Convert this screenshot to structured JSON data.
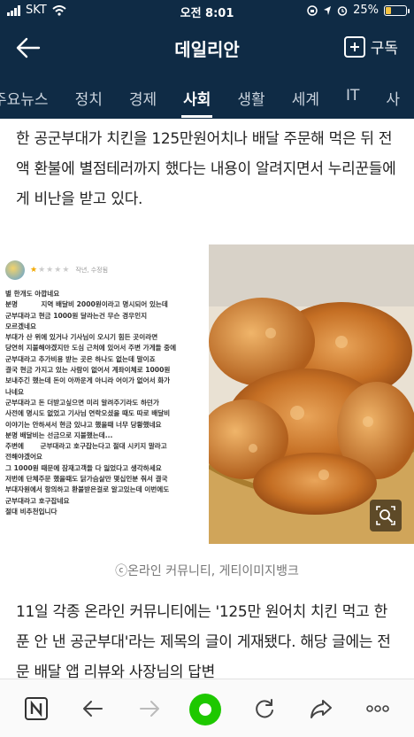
{
  "status_bar": {
    "carrier": "SKT",
    "time": "오전 8:01",
    "battery_percent": "25%",
    "battery_level": 0.25
  },
  "header": {
    "title": "데일리안",
    "subscribe_label": "구독",
    "back_icon": "back-arrow-icon"
  },
  "tabs": [
    {
      "label": "주요뉴스"
    },
    {
      "label": "정치"
    },
    {
      "label": "경제"
    },
    {
      "label": "사회"
    },
    {
      "label": "생활"
    },
    {
      "label": "세계"
    },
    {
      "label": "IT"
    },
    {
      "label": "사"
    }
  ],
  "article": {
    "intro": "한 공군부대가 치킨을 125만원어치나 배달 주문해 먹은 뒤 전액 환불에 별점테러까지 했다는 내용이 알려지면서 누리꾼들에게 비난을 받고 있다.",
    "review_meta": "작년, 수정됨",
    "review_text": "별 한개도 아깝네요\n분명          지역 배달비 2000원이라고 명시되어 있는데\n군부대라고 현금 1000원 달라는건 무슨 경우인지\n모르겠네요\n부대가 산 위에 있거나 기사님이 오시기 힘든 곳이라면\n당연히 지불해야겠지만 도심 근처에 있어서 주변 가게들 중에\n군부대라고 추가비용 받는 곳은 하나도 없는데 말이죠\n결국 현금 가지고 있는 사람이 없어서 계좌이체로 1000원\n보내주긴 했는데 돈이 아까운게 아니라 어이가 없어서 화가\n나네요\n군부대라고 돈 더받고싶으면 미리 알려주기라도 하던가\n사전에 명시도 없었고 기사님 연락오셨을 때도 따로 배달비\n이야기는 안하셔서 현금 있냐고 했을때 너무 당황했네요\n분명 배달비는 선금으로 지불했는데...\n주변에       군부대라고 호구잡는다고 절대 시키지 말라고\n전해야겠어요\n그 1000원 때문에 잠재고객들 다 잃었다고 생각하세요\n저번에 단체주문 했을때도 닭가슴살만 몇십인분 줘서 결국\n부대자원에서 항의하고 환불받은걸로 알고있는데 이번에도\n군부대라고 호구잡네요\n절대 비추천입니다",
    "rating": 1,
    "rating_max": 5,
    "caption": "ⓒ온라인 커뮤니티, 게티이미지뱅크",
    "body": "11일 각종 온라인 커뮤니티에는 '125만 원어치 치킨 먹고 한 푼 안 낸 공군부대'라는 제목의 글이 게재됐다. 해당 글에는 전문 배달 앱 리뷰와 사장님의 답변"
  },
  "bottom_bar": {
    "items": [
      "naver-n-icon",
      "back-arrow-icon",
      "forward-arrow-icon",
      "green-dot-icon",
      "refresh-icon",
      "share-icon",
      "more-icon"
    ]
  },
  "colors": {
    "header_bg": "#0f2b45",
    "accent_green": "#1ec800",
    "star": "#f2a900"
  }
}
